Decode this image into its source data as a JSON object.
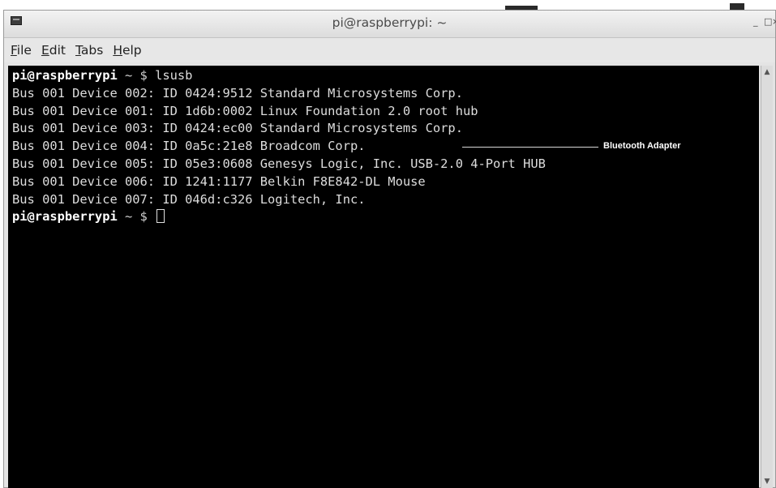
{
  "window": {
    "title": "pi@raspberrypi: ~",
    "controls": {
      "minimize": "_",
      "maximize": "□",
      "close": "×"
    }
  },
  "menubar": {
    "items": [
      {
        "underline": "F",
        "rest": "ile"
      },
      {
        "underline": "E",
        "rest": "dit"
      },
      {
        "underline": "T",
        "rest": "abs"
      },
      {
        "underline": "H",
        "rest": "elp"
      }
    ]
  },
  "terminal": {
    "prompt_user": "pi@raspberrypi",
    "prompt_rest": " ~ $ ",
    "command": "lsusb",
    "output_lines": [
      "Bus 001 Device 002: ID 0424:9512 Standard Microsystems Corp.",
      "Bus 001 Device 001: ID 1d6b:0002 Linux Foundation 2.0 root hub",
      "Bus 001 Device 003: ID 0424:ec00 Standard Microsystems Corp.",
      "Bus 001 Device 004: ID 0a5c:21e8 Broadcom Corp.",
      "Bus 001 Device 005: ID 05e3:0608 Genesys Logic, Inc. USB-2.0 4-Port HUB",
      "Bus 001 Device 006: ID 1241:1177 Belkin F8E842-DL Mouse",
      "Bus 001 Device 007: ID 046d:c326 Logitech, Inc."
    ],
    "annotation": "Bluetooth Adapter"
  },
  "scrollbar": {
    "up": "▲",
    "down": "▼"
  }
}
